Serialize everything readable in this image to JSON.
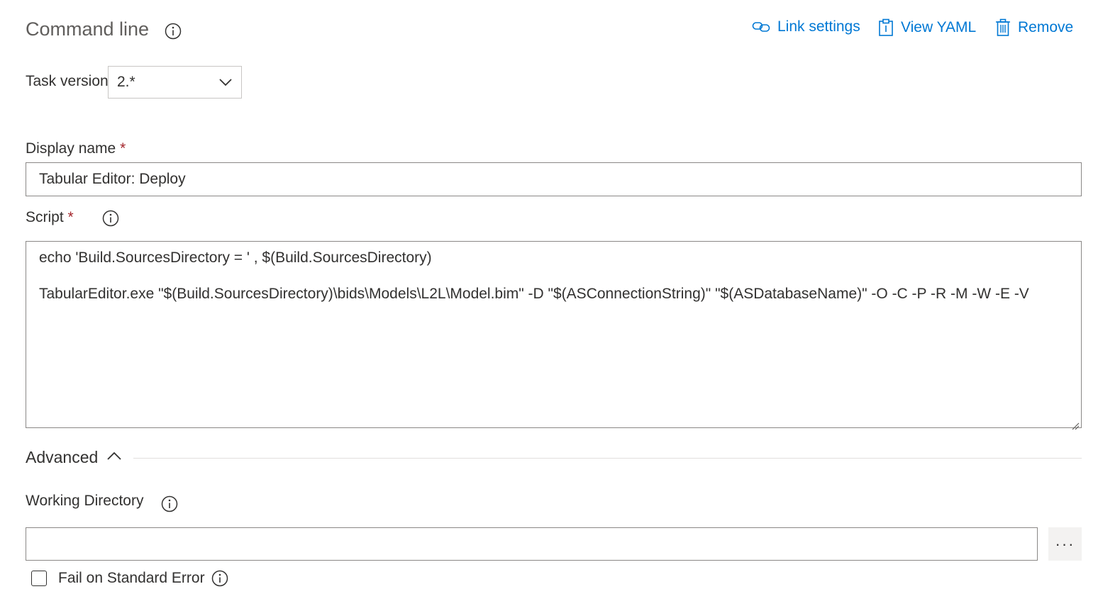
{
  "header": {
    "title": "Command line",
    "actions": {
      "link_settings": "Link settings",
      "view_yaml": "View YAML",
      "remove": "Remove"
    }
  },
  "task_version": {
    "label": "Task version",
    "value": "2.*"
  },
  "display_name": {
    "label": "Display name",
    "required_marker": "*",
    "value": "Tabular Editor: Deploy"
  },
  "script": {
    "label": "Script",
    "required_marker": "*",
    "lines": [
      "echo 'Build.SourcesDirectory = ' , $(Build.SourcesDirectory)",
      "TabularEditor.exe \"$(Build.SourcesDirectory)\\bids\\Models\\L2L\\Model.bim\" -D \"$(ASConnectionString)\" \"$(ASDatabaseName)\" -O -C -P -R -M -W -E -V"
    ]
  },
  "advanced": {
    "label": "Advanced"
  },
  "working_directory": {
    "label": "Working Directory",
    "value": "",
    "more_button": "···"
  },
  "fail_on_stderr": {
    "label": "Fail on Standard Error",
    "checked": false
  },
  "colors": {
    "accent": "#0078d4",
    "required": "#a4262c",
    "text": "#323130",
    "muted": "#605e5c"
  }
}
